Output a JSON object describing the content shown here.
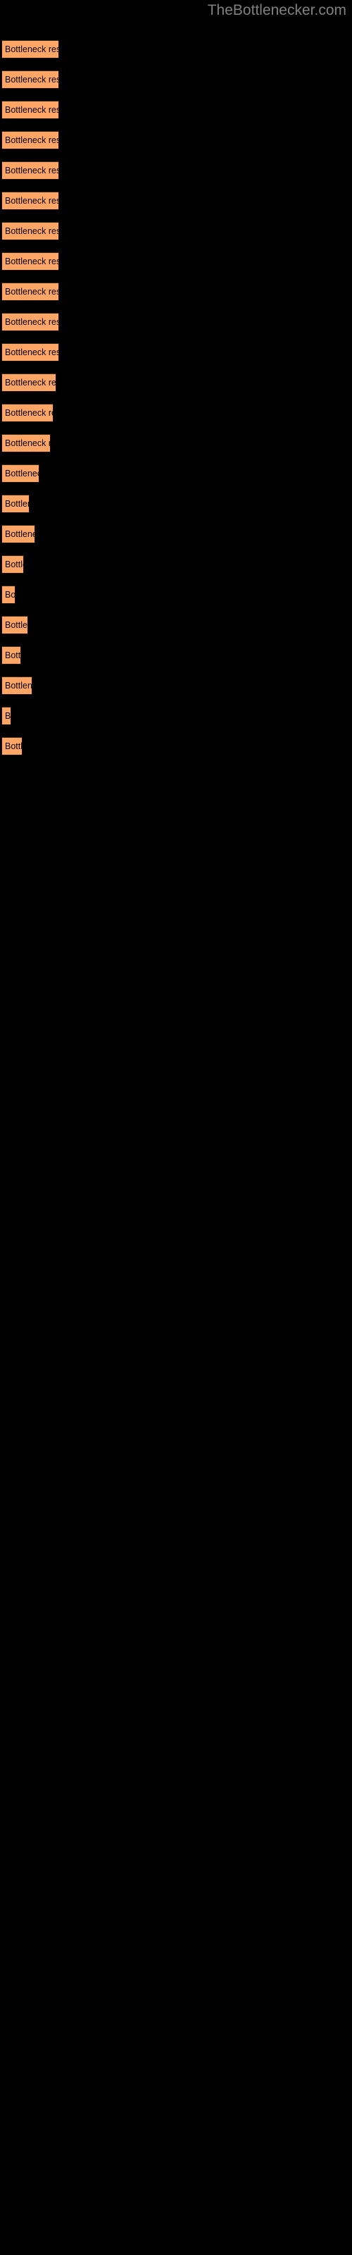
{
  "site": {
    "title": "TheBottlenecker.com",
    "title_color": "#808080",
    "background_color": "#000000"
  },
  "chart_data": {
    "type": "bar",
    "orientation": "horizontal",
    "title": "TheBottlenecker.com",
    "xlabel": "",
    "ylabel": "",
    "bar_color": "#ffa666",
    "bar_border_color": "#1a1008",
    "label_color": "#000000",
    "categories": [
      "Bottleneck result",
      "Bottleneck result",
      "Bottleneck result",
      "Bottleneck result",
      "Bottleneck result",
      "Bottleneck result",
      "Bottleneck result",
      "Bottleneck result",
      "Bottleneck result",
      "Bottleneck result",
      "Bottleneck result",
      "Bottleneck result",
      "Bottleneck result",
      "Bottleneck result",
      "Bottleneck result",
      "Bottleneck result",
      "Bottleneck result",
      "Bottleneck result",
      "Bottleneck result",
      "Bottleneck result",
      "Bottleneck result",
      "Bottleneck result",
      "Bottleneck result",
      "Bottleneck result"
    ],
    "values": [
      82,
      82,
      82,
      82,
      82,
      82,
      82,
      82,
      82,
      82,
      78,
      74,
      70,
      66,
      54,
      40,
      48,
      32,
      20,
      38,
      28,
      44,
      14,
      30
    ],
    "xlim": [
      0,
      500
    ],
    "grid": false,
    "legend": false
  },
  "bars": [
    {
      "label": "Bottleneck result",
      "width": 82,
      "top": 57
    },
    {
      "label": "Bottleneck result",
      "width": 82,
      "top": 100
    },
    {
      "label": "Bottleneck result",
      "width": 82,
      "top": 143
    },
    {
      "label": "Bottleneck result",
      "width": 82,
      "top": 186
    },
    {
      "label": "Bottleneck result",
      "width": 82,
      "top": 229
    },
    {
      "label": "Bottleneck result",
      "width": 82,
      "top": 272
    },
    {
      "label": "Bottleneck result",
      "width": 82,
      "top": 315
    },
    {
      "label": "Bottleneck result",
      "width": 82,
      "top": 358
    },
    {
      "label": "Bottleneck result",
      "width": 82,
      "top": 401
    },
    {
      "label": "Bottleneck result",
      "width": 82,
      "top": 444
    },
    {
      "label": "Bottleneck result",
      "width": 82,
      "top": 487
    },
    {
      "label": "Bottleneck result",
      "width": 78,
      "top": 530
    },
    {
      "label": "Bottleneck result",
      "width": 74,
      "top": 573
    },
    {
      "label": "Bottleneck result",
      "width": 70,
      "top": 616
    },
    {
      "label": "Bottleneck result",
      "width": 54,
      "top": 659
    },
    {
      "label": "Bottleneck result",
      "width": 40,
      "top": 702
    },
    {
      "label": "Bottleneck result",
      "width": 48,
      "top": 745
    },
    {
      "label": "Bottleneck result",
      "width": 32,
      "top": 788
    },
    {
      "label": "Bottleneck result",
      "width": 20,
      "top": 831
    },
    {
      "label": "Bottleneck result",
      "width": 38,
      "top": 874
    },
    {
      "label": "Bottleneck result",
      "width": 28,
      "top": 917
    },
    {
      "label": "Bottleneck result",
      "width": 44,
      "top": 960
    },
    {
      "label": "Bottleneck result",
      "width": 14,
      "top": 1003
    },
    {
      "label": "Bottleneck result",
      "width": 30,
      "top": 1046
    }
  ]
}
